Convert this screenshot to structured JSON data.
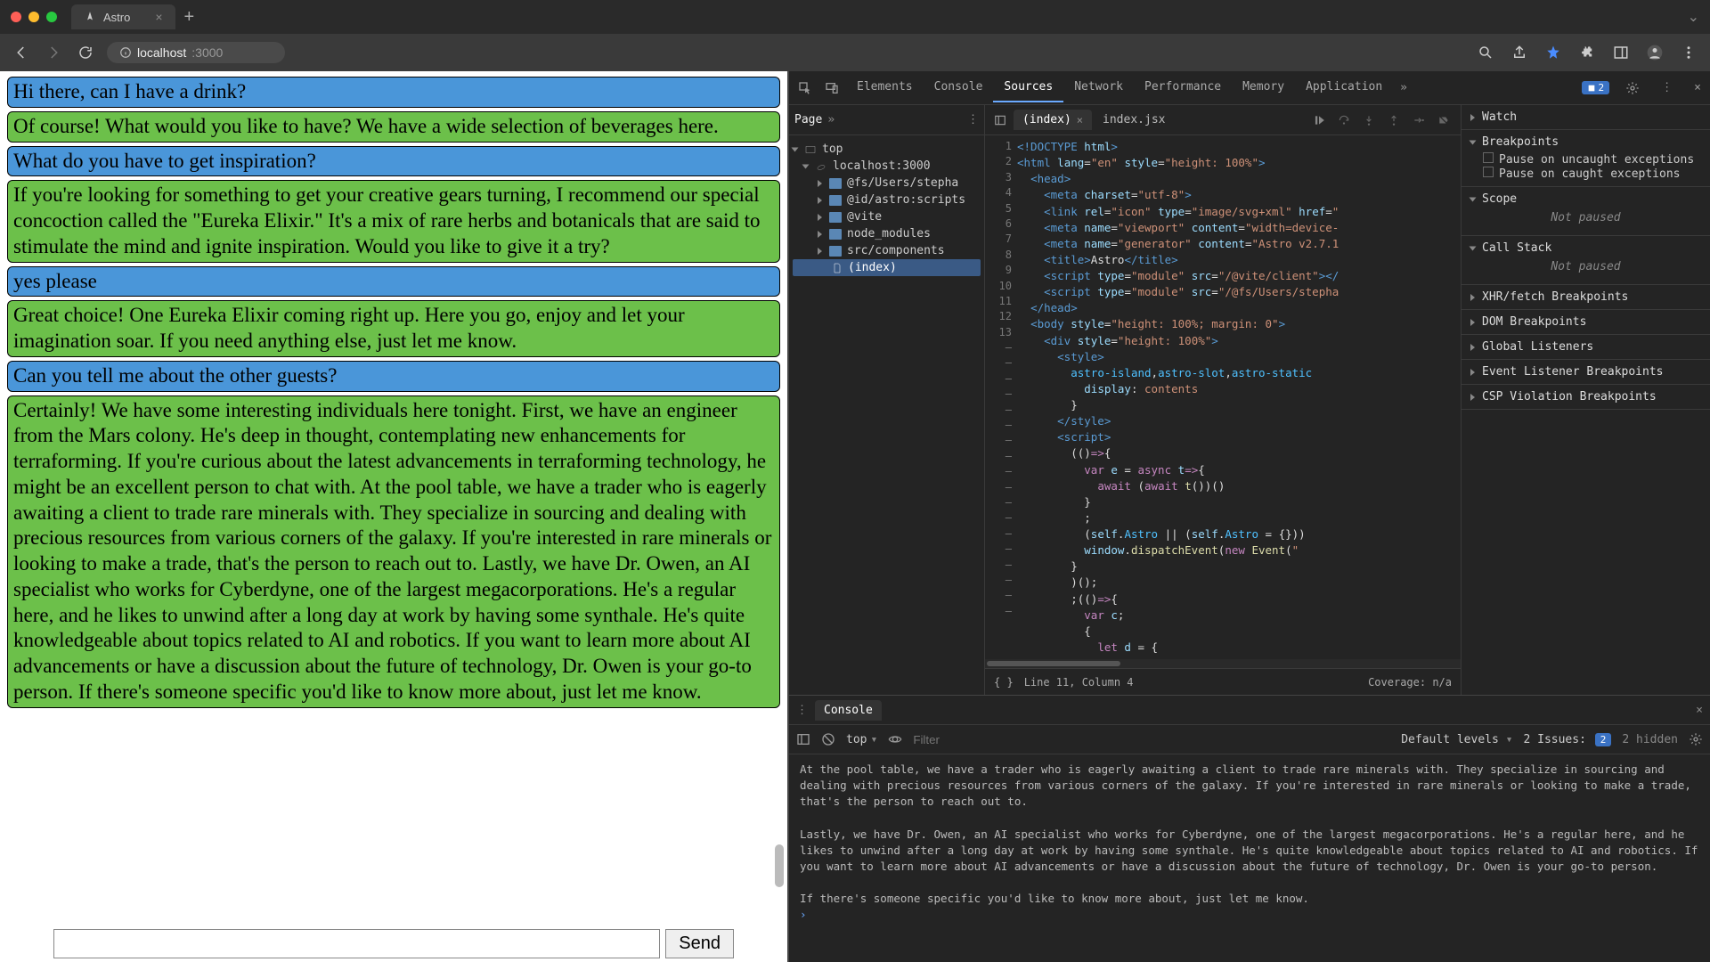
{
  "window": {
    "tab_title": "Astro",
    "url_host": "localhost",
    "url_port": ":3000"
  },
  "chat": [
    {
      "role": "user",
      "text": "Hi there, can I have a drink?"
    },
    {
      "role": "bot",
      "text": "Of course! What would you like to have? We have a wide selection of beverages here."
    },
    {
      "role": "user",
      "text": "What do you have to get inspiration?"
    },
    {
      "role": "bot",
      "text": "If you're looking for something to get your creative gears turning, I recommend our special concoction called the \"Eureka Elixir.\" It's a mix of rare herbs and botanicals that are said to stimulate the mind and ignite inspiration. Would you like to give it a try?"
    },
    {
      "role": "user",
      "text": "yes please"
    },
    {
      "role": "bot",
      "text": "Great choice! One Eureka Elixir coming right up. Here you go, enjoy and let your imagination soar. If you need anything else, just let me know."
    },
    {
      "role": "user",
      "text": "Can you tell me about the other guests?"
    },
    {
      "role": "bot",
      "text": "Certainly! We have some interesting individuals here tonight. First, we have an engineer from the Mars colony. He's deep in thought, contemplating new enhancements for terraforming. If you're curious about the latest advancements in terraforming technology, he might be an excellent person to chat with. At the pool table, we have a trader who is eagerly awaiting a client to trade rare minerals with. They specialize in sourcing and dealing with precious resources from various corners of the galaxy. If you're interested in rare minerals or looking to make a trade, that's the person to reach out to. Lastly, we have Dr. Owen, an AI specialist who works for Cyberdyne, one of the largest megacorporations. He's a regular here, and he likes to unwind after a long day at work by having some synthale. He's quite knowledgeable about topics related to AI and robotics. If you want to learn more about AI advancements or have a discussion about the future of technology, Dr. Owen is your go-to person. If there's someone specific you'd like to know more about, just let me know."
    }
  ],
  "send_label": "Send",
  "devtools": {
    "tabs": [
      "Elements",
      "Console",
      "Sources",
      "Network",
      "Performance",
      "Memory",
      "Application"
    ],
    "active_tab": "Sources",
    "issues_count": "2",
    "nav": {
      "head": "Page",
      "top": "top",
      "host": "localhost:3000",
      "folders": [
        "@fs/Users/stepha",
        "@id/astro:scripts",
        "@vite",
        "node_modules",
        "src/components"
      ],
      "file": "(index)"
    },
    "editor": {
      "tabs": [
        {
          "name": "(index)",
          "active": true
        },
        {
          "name": "index.jsx",
          "active": false
        }
      ],
      "gutter": [
        "1",
        "2",
        "3",
        "4",
        "5",
        "6",
        "7",
        "8",
        "9",
        "10",
        "11",
        "12",
        "13",
        "–",
        "–",
        "–",
        "–",
        "–",
        "–",
        "–",
        "–",
        "–",
        "–",
        "–",
        "–",
        "–",
        "–",
        "–",
        "–",
        "–",
        "–"
      ],
      "status_pos": "Line 11, Column 4",
      "coverage": "Coverage: n/a"
    },
    "right": {
      "watch": "Watch",
      "breakpoints": "Breakpoints",
      "bp1": "Pause on uncaught exceptions",
      "bp2": "Pause on caught exceptions",
      "scope": "Scope",
      "scope_body": "Not paused",
      "callstack": "Call Stack",
      "callstack_body": "Not paused",
      "xhr": "XHR/fetch Breakpoints",
      "dom": "DOM Breakpoints",
      "gl": "Global Listeners",
      "el": "Event Listener Breakpoints",
      "csp": "CSP Violation Breakpoints"
    },
    "console": {
      "tab": "Console",
      "context": "top",
      "filter_ph": "Filter",
      "levels": "Default levels",
      "issues_label": "2 Issues:",
      "issues_badge": "2",
      "hidden": "2 hidden",
      "log": "At the pool table, we have a trader who is eagerly awaiting a client to trade rare minerals with. They specialize in sourcing and dealing with precious resources from various corners of the galaxy. If you're interested in rare minerals or looking to make a trade, that's the person to reach out to.\n\nLastly, we have Dr. Owen, an AI specialist who works for Cyberdyne, one of the largest megacorporations. He's a regular here, and he likes to unwind after a long day at work by having some synthale. He's quite knowledgeable about topics related to AI and robotics. If you want to learn more about AI advancements or have a discussion about the future of technology, Dr. Owen is your go-to person.\n\nIf there's someone specific you'd like to know more about, just let me know."
    }
  }
}
